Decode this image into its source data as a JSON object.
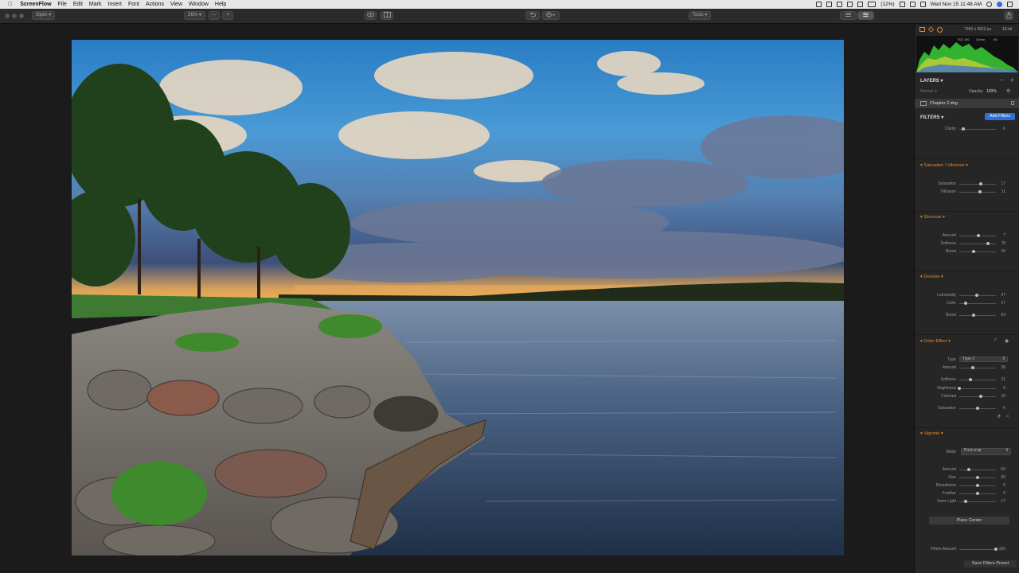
{
  "menubar": {
    "app_name": "ScreenFlow",
    "items": [
      "File",
      "Edit",
      "Mark",
      "Insert",
      "Font",
      "Actions",
      "View",
      "Window",
      "Help"
    ],
    "battery": "(12%)",
    "datetime": "Wed Nov 15  11:48 AM"
  },
  "toolbar": {
    "open_label": "Open",
    "zoom_label": "26%",
    "zoom_minus": "–",
    "zoom_plus": "+",
    "tools_label": "Tools"
  },
  "panel": {
    "image_info": "7360 x 4912 px",
    "bit_depth": "16-bit",
    "histogram_labels": [
      "ISO 100",
      "24mm",
      "f/8"
    ],
    "layers": {
      "title": "LAYERS",
      "blend_mode": "Normal",
      "opacity_label": "Opacity:",
      "opacity_value": "100%",
      "layer_name": "Chapter 2.dng"
    },
    "filters_title": "FILTERS",
    "add_filters": "Add Filters",
    "clarity": {
      "label": "Clarity",
      "value": "6",
      "level": 0.1
    },
    "saturation_vibrance": {
      "title": "Saturation / Vibrance",
      "rows": [
        {
          "label": "Saturation",
          "value": "17",
          "level": 0.58
        },
        {
          "label": "Vibrance",
          "value": "11",
          "level": 0.56
        }
      ]
    },
    "structure": {
      "title": "Structure",
      "rows": [
        {
          "label": "Amount",
          "value": "7",
          "level": 0.53
        },
        {
          "label": "Softness",
          "value": "78",
          "level": 0.78
        },
        {
          "label": "Boost",
          "value": "39",
          "level": 0.39
        }
      ]
    },
    "denoise": {
      "title": "Denoise",
      "rows": [
        {
          "label": "Luminosity",
          "value": "47",
          "level": 0.47
        },
        {
          "label": "Color",
          "value": "17",
          "level": 0.17
        },
        {
          "label": "Boost",
          "value": "63",
          "level": 0.39
        }
      ]
    },
    "orton": {
      "title": "Orton Effect",
      "type_label": "Type",
      "type_value": "Type 2",
      "rows": [
        {
          "label": "Amount",
          "value": "38",
          "level": 0.38
        },
        {
          "label": "Softness",
          "value": "31",
          "level": 0.31
        },
        {
          "label": "Brightness",
          "value": "0",
          "level": 0.0
        },
        {
          "label": "Contrast",
          "value": "15",
          "level": 0.58
        },
        {
          "label": "Saturation",
          "value": "0",
          "level": 0.5
        }
      ]
    },
    "vignette": {
      "title": "Vignette",
      "mode_label": "Mode",
      "mode_value": "Post-crop",
      "rows": [
        {
          "label": "Amount",
          "value": "-50",
          "level": 0.25
        },
        {
          "label": "Size",
          "value": "50",
          "level": 0.5
        },
        {
          "label": "Roundness",
          "value": "0",
          "level": 0.5
        },
        {
          "label": "Feather",
          "value": "0",
          "level": 0.5
        },
        {
          "label": "Inner Light",
          "value": "17",
          "level": 0.17
        }
      ],
      "place_center": "Place Center"
    },
    "filters_amount": {
      "label": "Filters Amount",
      "value": "100",
      "level": 1.0
    },
    "save_preset": "Save Filters Preset"
  },
  "colors": {
    "accent": "#e08a2a",
    "button_blue": "#2f6fd6",
    "panel_bg": "#262626"
  }
}
